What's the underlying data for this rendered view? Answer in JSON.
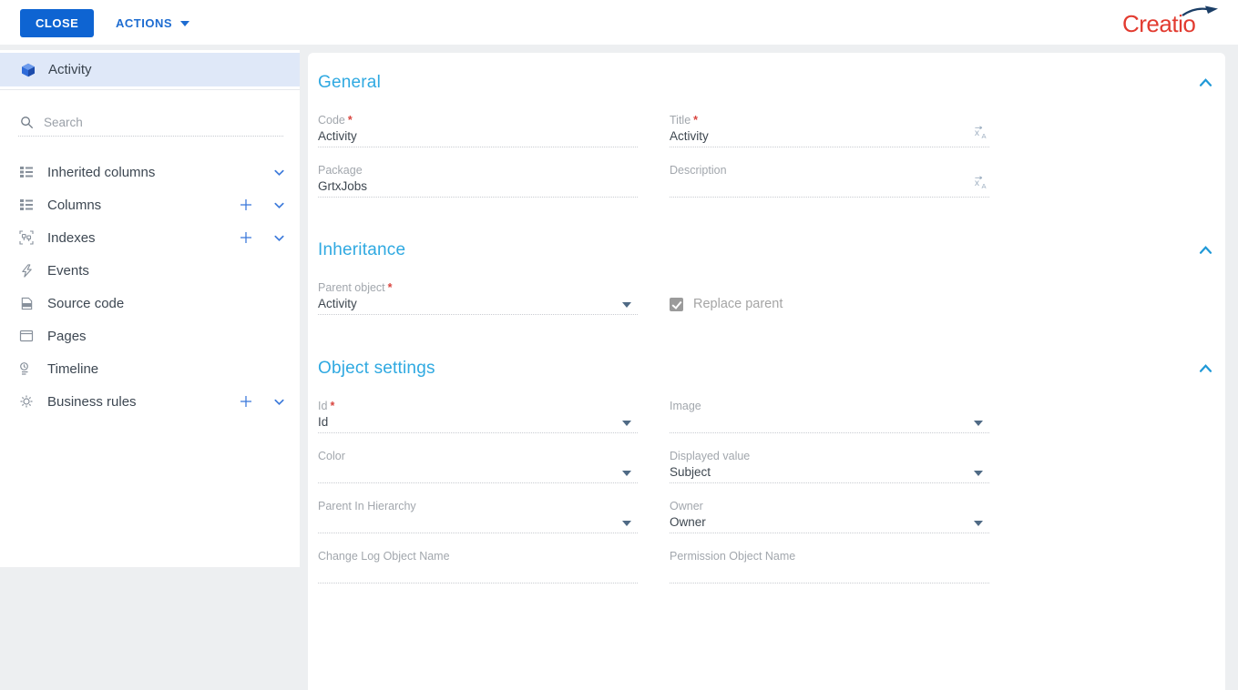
{
  "ui": {
    "required_marker": "*"
  },
  "topbar": {
    "close_label": "CLOSE",
    "actions_label": "ACTIONS",
    "brand": "Creatio"
  },
  "sidebar": {
    "selected_item": {
      "label": "Activity"
    },
    "search": {
      "placeholder": "Search"
    },
    "items": [
      {
        "label": "Inherited columns",
        "icon": "columns-list-icon",
        "has_add": false,
        "has_chevron": true
      },
      {
        "label": "Columns",
        "icon": "columns-list-icon",
        "has_add": true,
        "has_chevron": true
      },
      {
        "label": "Indexes",
        "icon": "indexes-icon",
        "has_add": true,
        "has_chevron": true
      },
      {
        "label": "Events",
        "icon": "lightning-icon",
        "has_add": false,
        "has_chevron": false
      },
      {
        "label": "Source code",
        "icon": "source-code-icon",
        "has_add": false,
        "has_chevron": false
      },
      {
        "label": "Pages",
        "icon": "page-icon",
        "has_add": false,
        "has_chevron": false
      },
      {
        "label": "Timeline",
        "icon": "timeline-icon",
        "has_add": false,
        "has_chevron": false
      },
      {
        "label": "Business rules",
        "icon": "gear-icon",
        "has_add": true,
        "has_chevron": true
      }
    ]
  },
  "main": {
    "sections": [
      {
        "title": "General",
        "fields": [
          {
            "label": "Code",
            "value": "Activity",
            "required": true,
            "control": "text"
          },
          {
            "label": "Title",
            "value": "Activity",
            "required": true,
            "control": "text",
            "localizable": true
          },
          {
            "label": "Package",
            "value": "GrtxJobs",
            "required": false,
            "control": "text"
          },
          {
            "label": "Description",
            "value": "",
            "required": false,
            "control": "text",
            "localizable": true
          }
        ]
      },
      {
        "title": "Inheritance",
        "fields": [
          {
            "label": "Parent object",
            "value": "Activity",
            "required": true,
            "control": "dropdown"
          }
        ],
        "checkbox": {
          "label": "Replace parent",
          "checked": true,
          "disabled": true
        }
      },
      {
        "title": "Object settings",
        "fields": [
          {
            "label": "Id",
            "value": "Id",
            "required": true,
            "control": "dropdown"
          },
          {
            "label": "Image",
            "value": "",
            "required": false,
            "control": "dropdown"
          },
          {
            "label": "Color",
            "value": "",
            "required": false,
            "control": "dropdown"
          },
          {
            "label": "Displayed value",
            "value": "Subject",
            "required": false,
            "control": "dropdown"
          },
          {
            "label": "Parent In Hierarchy",
            "value": "",
            "required": false,
            "control": "dropdown"
          },
          {
            "label": "Owner",
            "value": "Owner",
            "required": false,
            "control": "dropdown"
          },
          {
            "label": "Change Log Object Name",
            "value": "",
            "required": false,
            "control": "text"
          },
          {
            "label": "Permission Object Name",
            "value": "",
            "required": false,
            "control": "text"
          }
        ]
      }
    ]
  },
  "colors": {
    "accent_blue": "#0e64d2",
    "link_blue": "#1d6cd1",
    "section_heading": "#2fa9e1",
    "brand_red": "#e23b30",
    "selected_row_bg": "#dfe8f8",
    "collapse_chevron": "#1e98d7"
  }
}
